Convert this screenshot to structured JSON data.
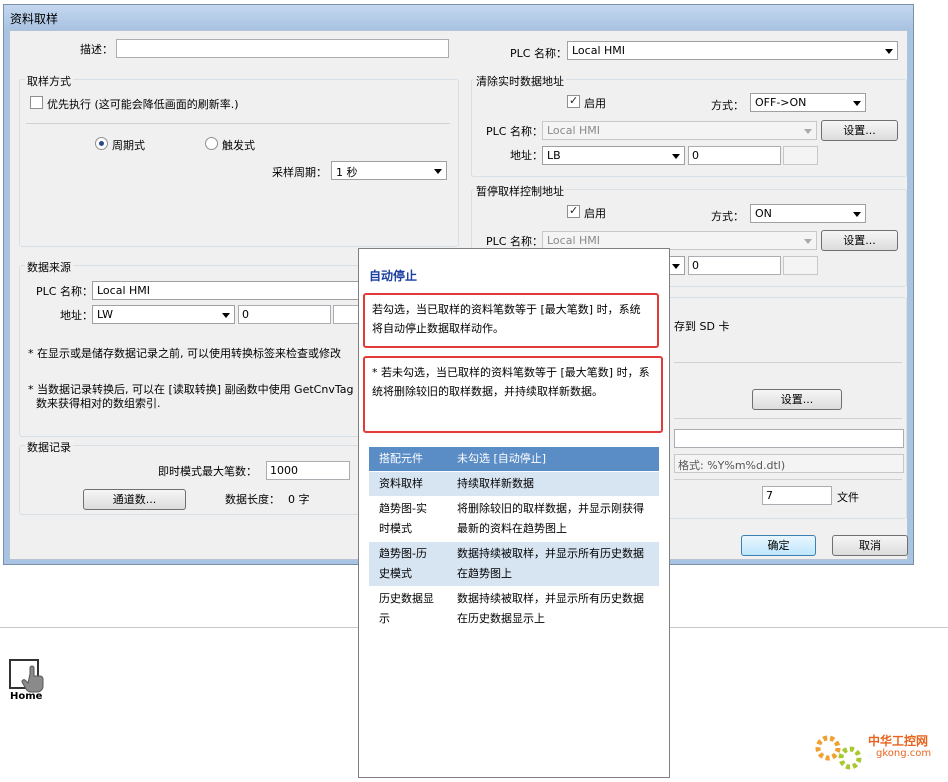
{
  "window": {
    "title": "资料取样"
  },
  "top": {
    "desc_label": "描述：",
    "desc_value": "",
    "plc_label": "PLC 名称：",
    "plc_value": "Local HMI"
  },
  "sampling": {
    "group_label": "取样方式",
    "priority_label": "优先执行 (这可能会降低画面的刷新率.)",
    "priority_checked": false,
    "periodic_label": "周期式",
    "trigger_label": "触发式",
    "selected": "periodic",
    "period_label": "采样周期：",
    "period_value": "1 秒"
  },
  "clear_addr": {
    "group_label": "清除实时数据地址",
    "enable_label": "启用",
    "enabled": true,
    "mode_label": "方式：",
    "mode_value": "OFF->ON",
    "plc_label": "PLC 名称：",
    "plc_value": "Local HMI",
    "settings_button": "设置...",
    "addr_label": "地址：",
    "addr_type": "LB",
    "addr_value": "0"
  },
  "pause_addr": {
    "group_label": "暂停取样控制地址",
    "enable_label": "启用",
    "enabled": true,
    "mode_label": "方式：",
    "mode_value": "ON",
    "plc_label": "PLC 名称：",
    "plc_value": "Local HMI",
    "settings_button": "设置...",
    "addr_value": "0"
  },
  "source": {
    "group_label": "数据来源",
    "plc_label": "PLC 名称：",
    "plc_value": "Local HMI",
    "addr_label": "地址：",
    "addr_type": "LW",
    "addr_value": "0",
    "note1": "* 在显示或是储存数据记录之前, 可以使用转换标签来检查或修改",
    "note2": "* 当数据记录转换后, 可以在 [读取转换] 副函数中使用 GetCnvTag",
    "note2b": "数来获得相对的数组索引."
  },
  "record": {
    "group_label": "数据记录",
    "max_label": "即时模式最大笔数：",
    "max_value": "1000",
    "channels_button": "通道数...",
    "length_label": "数据长度：",
    "length_value": "0 字"
  },
  "right_lower": {
    "save_sd": "存到 SD 卡",
    "settings_button": "设置...",
    "format_text": "格式: %Y%m%d.dtl)",
    "files_value": "7",
    "files_label": "文件"
  },
  "footer": {
    "ok": "确定",
    "cancel": "取消"
  },
  "popup": {
    "title": "自动停止",
    "box1": "若勾选，当已取样的资料笔数等于 [最大笔数] 时，系统将自动停止数据取样动作。",
    "box2": "* 若未勾选，当已取样的资料笔数等于 [最大笔数] 时，系统将删除较旧的取样数据，并持续取样新数据。",
    "table": {
      "headers": [
        "搭配元件",
        "未勾选 [自动停止]"
      ],
      "rows": [
        [
          "资料取样",
          "持续取样新数据"
        ],
        [
          "趋势图-实时模式",
          "将删除较旧的取样数据，并显示刚获得最新的资料在趋势图上"
        ],
        [
          "趋势图-历史模式",
          "数据持续被取样，并显示所有历史数据在趋势图上"
        ],
        [
          "历史数据显示",
          "数据持续被取样，并显示所有历史数据在历史数据显示上"
        ]
      ]
    }
  },
  "home": {
    "label": "Home"
  },
  "watermark": {
    "cn": "中华工控网",
    "url": "gkong.com"
  }
}
